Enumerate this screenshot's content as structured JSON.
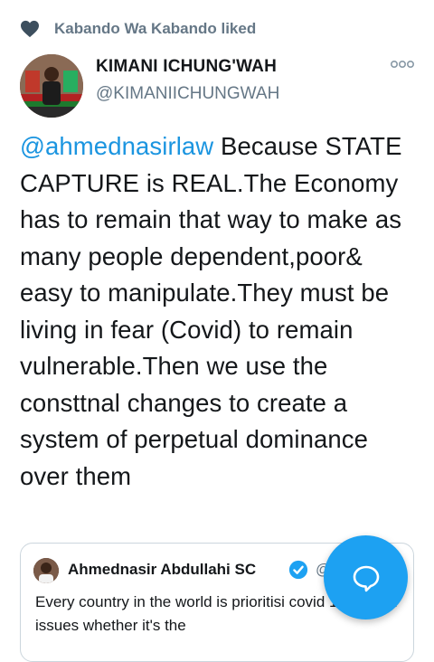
{
  "social_context": {
    "icon": "heart-icon",
    "text": "Kabando Wa Kabando liked"
  },
  "author": {
    "name": "KIMANI ICHUNG'WAH",
    "handle": "@KIMANIICHUNGWAH"
  },
  "tweet": {
    "mention": "@ahmednasirlaw",
    "text": " Because STATE CAPTURE is REAL.The Economy has to remain that way to make as many people dependent,poor& easy to manipulate.They must be living in fear (Covid) to remain vulnerable.Then we use the consttnal changes to create a system of perpetual dominance over them"
  },
  "quoted_tweet": {
    "name": "Ahmednasir Abdullahi SC",
    "handle": "@a",
    "text": "Every country in the world is prioritisi covid 19 related issues whether it's the"
  },
  "colors": {
    "accent": "#1da1f2",
    "link": "#1b95e0",
    "secondary_text": "#657786"
  }
}
